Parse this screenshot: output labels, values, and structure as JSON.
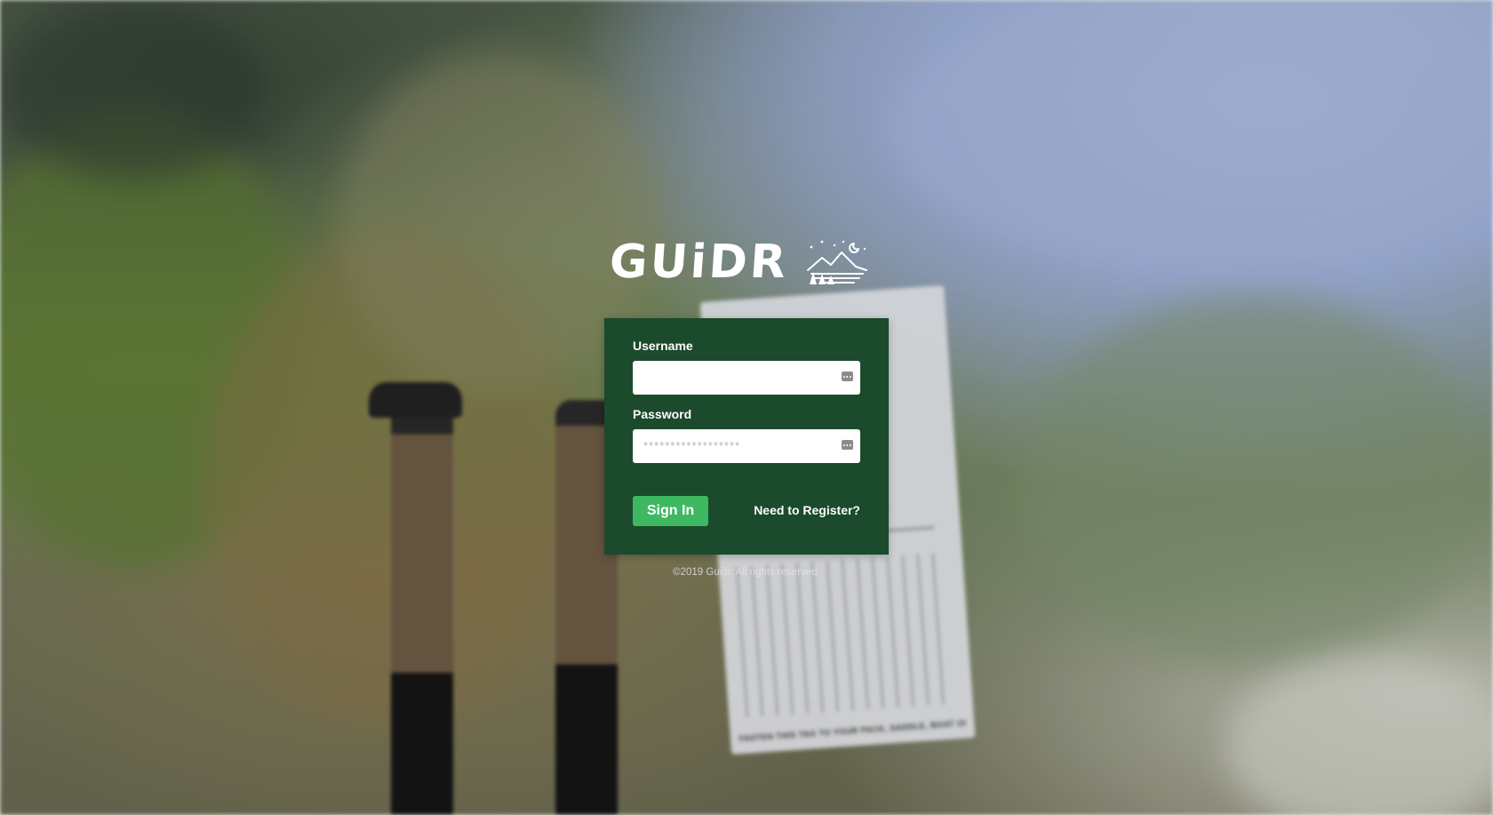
{
  "app": {
    "brand": "GUiDR",
    "logo_icon": "mountains-moon-trees-icon"
  },
  "login": {
    "username_label": "Username",
    "username_value": "",
    "password_label": "Password",
    "password_placeholder": "******************",
    "password_value": "",
    "field_icon": "key-icon",
    "signin_label": "Sign In",
    "register_label": "Need to Register?"
  },
  "footer": {
    "copyright": "©2019 Guidr. All rights reserved."
  },
  "colors": {
    "card_bg": "#1b4a2c",
    "button_bg": "#3fb862",
    "text": "#ffffff"
  }
}
